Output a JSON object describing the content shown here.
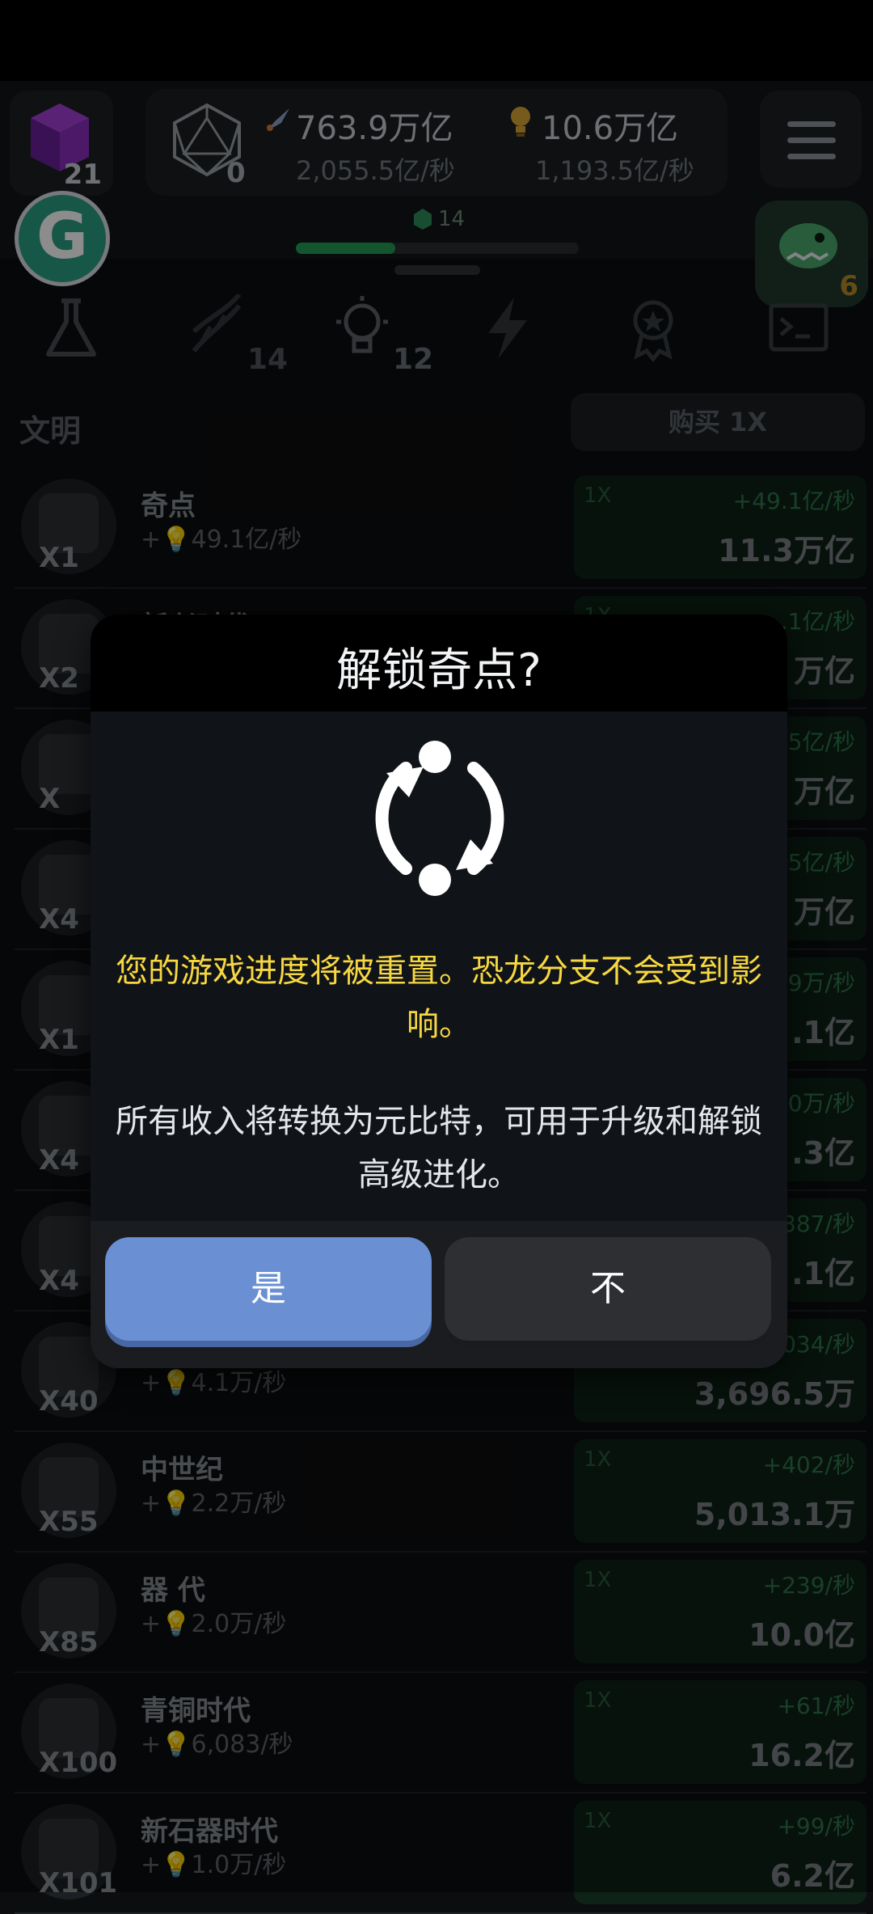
{
  "header": {
    "cube_count": "21",
    "d20_count": "0",
    "resource_a": {
      "value": "763.9万亿",
      "rate": "2,055.5亿/秒",
      "icon": "rocket-icon"
    },
    "resource_b": {
      "value": "10.6万亿",
      "rate": "1,193.5亿/秒",
      "icon": "lightbulb-icon"
    },
    "g_label": "G",
    "dino_count": "6",
    "progress_label": "14",
    "progress_fraction": 0.35
  },
  "tabs": [
    {
      "name": "flask-icon",
      "badge": ""
    },
    {
      "name": "dna-icon",
      "badge": "14"
    },
    {
      "name": "lightbulb-icon",
      "badge": "12"
    },
    {
      "name": "lightning-icon",
      "badge": ""
    },
    {
      "name": "award-icon",
      "badge": ""
    },
    {
      "name": "terminal-icon",
      "badge": ""
    }
  ],
  "section": {
    "title": "文明",
    "buy_label": "购买 1X"
  },
  "rows": [
    {
      "name": "奇点",
      "mult": "X1",
      "rate": "+💡49.1亿/秒",
      "qty": "1X",
      "inc": "+49.1亿/秒",
      "cost": "11.3万亿"
    },
    {
      "name": "新兴时代",
      "mult": "X2",
      "rate": "",
      "qty": "1X",
      "inc": ".1亿/秒",
      "cost": "万亿"
    },
    {
      "name": "",
      "mult": "X",
      "rate": "",
      "qty": "1X",
      "inc": "5亿/秒",
      "cost": "万亿"
    },
    {
      "name": "",
      "mult": "X4",
      "rate": "",
      "qty": "1X",
      "inc": "5亿/秒",
      "cost": "万亿"
    },
    {
      "name": "",
      "mult": "X1",
      "rate": "",
      "qty": "1X",
      "inc": "9万/秒",
      "cost": ".1亿"
    },
    {
      "name": "",
      "mult": "X4",
      "rate": "",
      "qty": "1X",
      "inc": "0万/秒",
      "cost": ".3亿"
    },
    {
      "name": "",
      "mult": "X4",
      "rate": "",
      "qty": "1X",
      "inc": "387/秒",
      "cost": ".1亿"
    },
    {
      "name": "",
      "mult": "X40",
      "rate": "+💡4.1万/秒",
      "qty": "1X",
      "inc": "034/秒",
      "cost": "3,696.5万"
    },
    {
      "name": "中世纪",
      "mult": "X55",
      "rate": "+💡2.2万/秒",
      "qty": "1X",
      "inc": "+402/秒",
      "cost": "5,013.1万"
    },
    {
      "name": "器 代",
      "mult": "X85",
      "rate": "+💡2.0万/秒",
      "qty": "1X",
      "inc": "+239/秒",
      "cost": "10.0亿"
    },
    {
      "name": "青铜时代",
      "mult": "X100",
      "rate": "+💡6,083/秒",
      "qty": "1X",
      "inc": "+61/秒",
      "cost": "16.2亿"
    },
    {
      "name": "新石器时代",
      "mult": "X101",
      "rate": "+💡1.0万/秒",
      "qty": "1X",
      "inc": "+99/秒",
      "cost": "6.2亿"
    }
  ],
  "dialog": {
    "title": "解锁奇点?",
    "icon": "refresh-cycle-icon",
    "warning": "您的游戏进度将被重置。恐龙分支不会受到影响。",
    "info": "所有收入将转换为元比特，可用于升级和解锁高级进化。",
    "yes_label": "是",
    "no_label": "不"
  },
  "colors": {
    "accent_blue": "#6a8fd3",
    "warning_yellow": "#f6d742",
    "progress_green": "#249c57"
  }
}
